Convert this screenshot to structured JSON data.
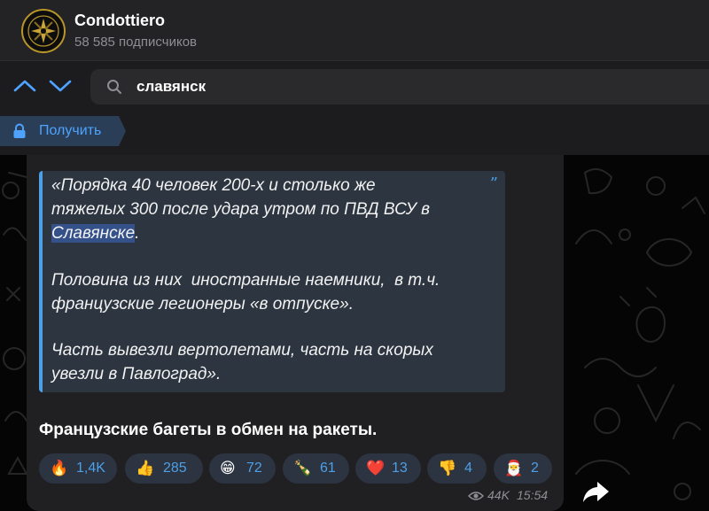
{
  "channel": {
    "name": "Condottiero",
    "subscribers": "58 585 подписчиков"
  },
  "search": {
    "query": "славянск"
  },
  "get_button": {
    "label": "Получить"
  },
  "message": {
    "quote": {
      "p1_line1": "«Порядка 40 человек 200-х и столько же",
      "p1_line2": "тяжелых 300 после удара утром по ПВД ВСУ в",
      "p1_highlight": "Славянске",
      "p1_tail": ".",
      "p2_line1": "Половина из них  иностранные наемники,  в т.ч.",
      "p2_line2": "французские легионеры «в отпуске».",
      "p3_line1": "Часть вывезли вертолетами, часть на скорых",
      "p3_line2": "увезли в Павлоград»."
    },
    "caption": "Французские багеты в обмен на ракеты.",
    "reactions": [
      {
        "emoji": "🔥",
        "count": "1,4K"
      },
      {
        "emoji": "👍",
        "count": "285"
      },
      {
        "emoji": "😁",
        "count": "72"
      },
      {
        "emoji": "🍾",
        "count": "61"
      },
      {
        "emoji": "❤️",
        "count": "13"
      },
      {
        "emoji": "👎",
        "count": "4"
      },
      {
        "emoji": "🎅",
        "count": "2"
      }
    ],
    "views": "44K",
    "time": "15:54"
  },
  "icons": {
    "nav_up": "chevron-up-icon",
    "nav_down": "chevron-down-icon",
    "search": "search-icon",
    "lock": "lock-icon",
    "eye": "eye-icon",
    "share": "share-icon",
    "quote": "quote-mark-icon"
  },
  "colors": {
    "accent": "#4d9fe6",
    "bubble": "#202022",
    "quote_bg": "#2d3540",
    "reaction_bg": "#2c3442",
    "highlight": "#35518a"
  }
}
